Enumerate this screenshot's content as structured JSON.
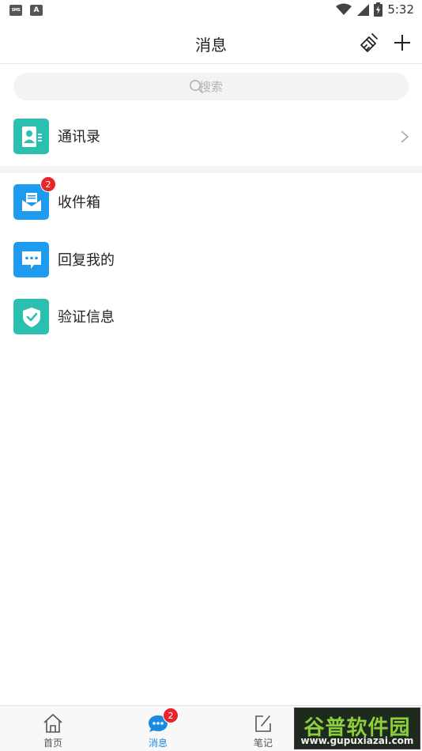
{
  "status_bar": {
    "left_icons": [
      "sms-icon",
      "keyboard-a-icon"
    ],
    "left_labels": [
      "SMS",
      "A"
    ],
    "time": "5:32"
  },
  "header": {
    "title": "消息"
  },
  "search": {
    "placeholder": "搜索",
    "value": ""
  },
  "rows": {
    "contacts": {
      "label": "通讯录",
      "icon": "contacts-icon",
      "color": "#2bbfb0"
    },
    "inbox": {
      "label": "收件箱",
      "icon": "mail-icon",
      "color": "#1e9bef",
      "badge": "2"
    },
    "replies": {
      "label": "回复我的",
      "icon": "chat-bubble-icon",
      "color": "#1e9bef"
    },
    "verify": {
      "label": "验证信息",
      "icon": "shield-check-icon",
      "color": "#2bbfb0"
    }
  },
  "tabbar": {
    "home": {
      "label": "首页",
      "icon": "home-icon"
    },
    "messages": {
      "label": "消息",
      "icon": "chat-icon",
      "badge": "2",
      "active": true
    },
    "notes": {
      "label": "笔记",
      "icon": "edit-note-icon"
    }
  },
  "watermark": {
    "main": "谷普软件园",
    "sub": "www.gupuxiazai.com"
  },
  "colors": {
    "accent": "#1a8ae0",
    "badge": "#e8232a",
    "teal": "#2bbfb0",
    "blue": "#1e9bef"
  }
}
